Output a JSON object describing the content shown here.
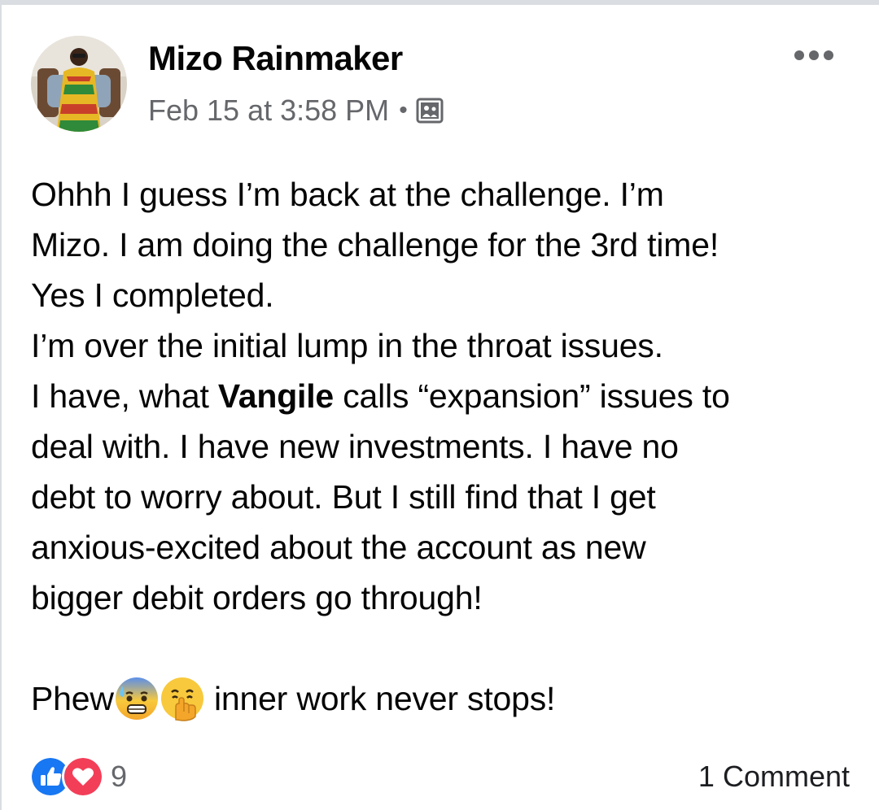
{
  "post": {
    "author": "Mizo Rainmaker",
    "timestamp": "Feb 15 at 3:58 PM",
    "separator": "•",
    "audience_icon": "custom-audience-icon",
    "more_icon": "more-options-icon",
    "body": {
      "line1": "Ohhh I guess I’m back at the challenge. I’m",
      "line2": "Mizo. I am doing the challenge for the 3rd time!",
      "line3": "Yes I completed.",
      "line4": "I’m over the initial lump in the throat issues.",
      "line5_before": "I have, what ",
      "line5_mention": "Vangile",
      "line5_after": " calls “expansion” issues to",
      "line6": "deal with. I have new investments. I have no",
      "line7": "debt to worry about. But I still find that I get",
      "line8": "anxious-excited about the account as new",
      "line9": "bigger debit orders go through!",
      "line10_before": "Phew",
      "line10_after": " inner work never stops!"
    },
    "emojis": [
      "anxious-face-with-sweat-emoji",
      "face-with-hand-over-mouth-emoji"
    ]
  },
  "footer": {
    "reactions": [
      "like-reaction-icon",
      "love-reaction-icon"
    ],
    "reaction_count": "9",
    "comments_label": "1 Comment"
  },
  "colors": {
    "like_blue": "#1877f2",
    "love_red": "#f33e58",
    "secondary_text": "#65676b",
    "border": "#dadde1"
  }
}
